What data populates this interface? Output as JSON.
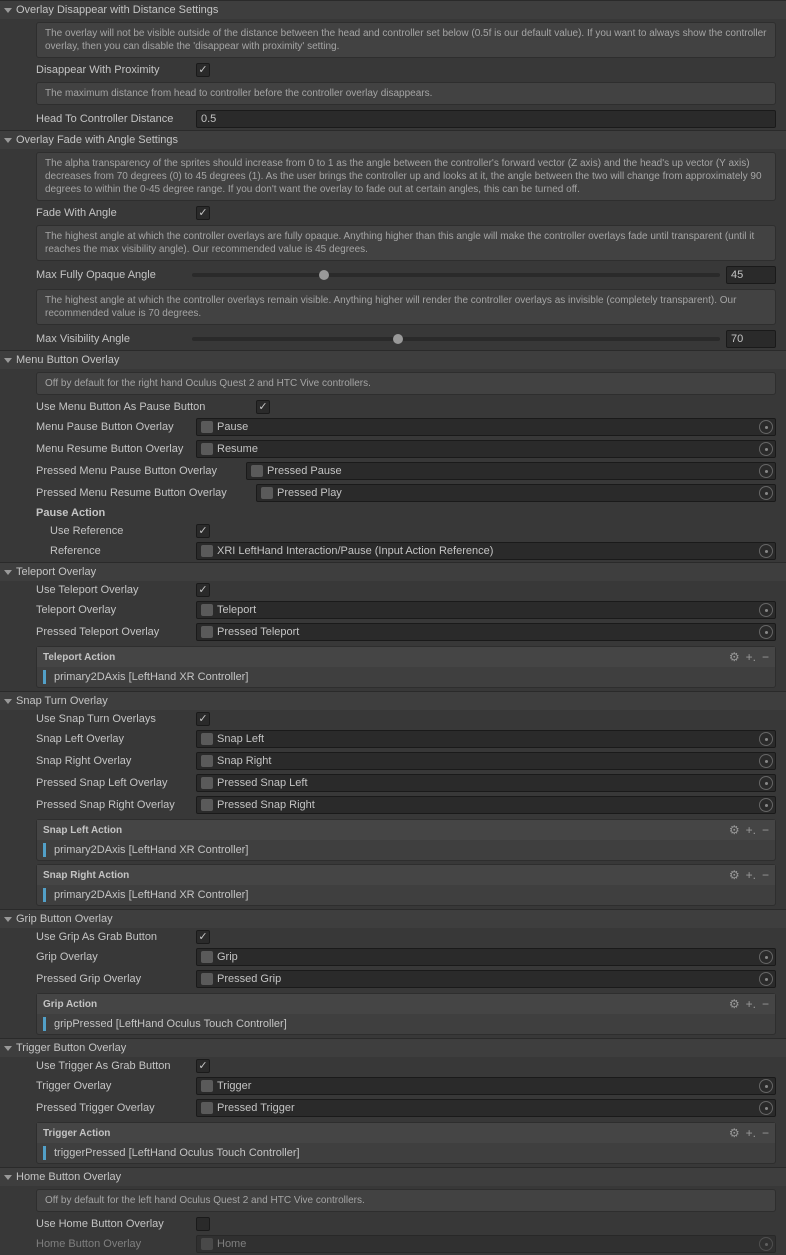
{
  "distance": {
    "header": "Overlay Disappear with Distance Settings",
    "help1": "The overlay will not be visible outside of the distance between the head and controller set below (0.5f is our default value). If you want to always show the controller overlay, then you can disable the 'disappear with proximity' setting.",
    "disappearLabel": "Disappear With Proximity",
    "help2": "The maximum distance from head to controller before the controller overlay disappears.",
    "headDistLabel": "Head To Controller Distance",
    "headDist": "0.5"
  },
  "fade": {
    "header": "Overlay Fade with Angle Settings",
    "help1": "The alpha transparency of the sprites should increase from 0 to 1 as the angle between the controller's forward vector (Z axis) and the head's up vector (Y axis) decreases from 70 degrees (0) to 45 degrees (1). As the user brings the controller up and looks at it, the angle between the two will change from approximately 90 degrees to within the 0-45 degree range. If you don't want the overlay to fade out at certain angles, this can be turned off.",
    "fadeLabel": "Fade With Angle",
    "help2": "The highest angle at which the controller overlays are fully opaque. Anything higher than this angle will make the controller overlays fade until transparent (until it reaches the max visibility angle). Our recommended value is 45 degrees.",
    "opaqueLabel": "Max Fully Opaque Angle",
    "opaqueVal": "45",
    "help3": "The highest angle at which the controller overlays remain visible. Anything higher will render the controller overlays as invisible (completely transparent). Our recommended value is 70 degrees.",
    "visLabel": "Max Visibility Angle",
    "visVal": "70"
  },
  "menu": {
    "header": "Menu Button Overlay",
    "help": "Off by default for the right hand Oculus Quest 2 and HTC Vive controllers.",
    "useLabel": "Use Menu Button As Pause Button",
    "pauseOverlayLabel": "Menu Pause Button Overlay",
    "pauseOverlay": "Pause",
    "resumeOverlayLabel": "Menu Resume Button Overlay",
    "resumeOverlay": "Resume",
    "pressedPauseLabel": "Pressed Menu Pause Button Overlay",
    "pressedPause": "Pressed Pause",
    "pressedResumeLabel": "Pressed Menu Resume Button Overlay",
    "pressedResume": "Pressed Play",
    "pauseAction": "Pause Action",
    "useRefLabel": "Use Reference",
    "refLabel": "Reference",
    "ref": "XRI LeftHand Interaction/Pause (Input Action Reference)"
  },
  "teleport": {
    "header": "Teleport Overlay",
    "useLabel": "Use Teleport Overlay",
    "overlayLabel": "Teleport Overlay",
    "overlay": "Teleport",
    "pressedLabel": "Pressed Teleport Overlay",
    "pressed": "Pressed Teleport",
    "actionName": "Teleport Action",
    "binding": "primary2DAxis [LeftHand XR Controller]"
  },
  "snap": {
    "header": "Snap Turn Overlay",
    "useLabel": "Use Snap Turn Overlays",
    "leftLabel": "Snap Left Overlay",
    "left": "Snap Left",
    "rightLabel": "Snap Right Overlay",
    "right": "Snap Right",
    "pLeftLabel": "Pressed Snap Left Overlay",
    "pLeft": "Pressed Snap Left",
    "pRightLabel": "Pressed Snap Right Overlay",
    "pRight": "Pressed Snap Right",
    "leftAction": "Snap Left Action",
    "leftBinding": "primary2DAxis [LeftHand XR Controller]",
    "rightAction": "Snap Right Action",
    "rightBinding": "primary2DAxis [LeftHand XR Controller]"
  },
  "grip": {
    "header": "Grip Button Overlay",
    "useLabel": "Use Grip As Grab Button",
    "overlayLabel": "Grip Overlay",
    "overlay": "Grip",
    "pressedLabel": "Pressed Grip Overlay",
    "pressed": "Pressed Grip",
    "actionName": "Grip Action",
    "binding": "gripPressed [LeftHand Oculus Touch Controller]"
  },
  "trigger": {
    "header": "Trigger Button Overlay",
    "useLabel": "Use Trigger As Grab Button",
    "overlayLabel": "Trigger Overlay",
    "overlay": "Trigger",
    "pressedLabel": "Pressed Trigger Overlay",
    "pressed": "Pressed Trigger",
    "actionName": "Trigger Action",
    "binding": "triggerPressed [LeftHand Oculus Touch Controller]"
  },
  "home": {
    "header": "Home Button Overlay",
    "help": "Off by default for the left hand Oculus Quest 2 and HTC Vive controllers.",
    "useLabel": "Use Home Button Overlay",
    "overlayLabel": "Home Button Overlay",
    "overlay": "Home"
  }
}
